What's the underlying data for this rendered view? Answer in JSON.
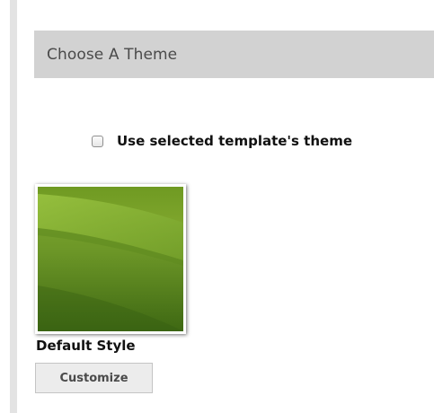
{
  "section": {
    "title": "Choose A Theme"
  },
  "theme_option": {
    "label": "Use selected template's theme",
    "checked": false
  },
  "themes": [
    {
      "name": "Default Style",
      "customize_label": "Customize",
      "swatch_colors": {
        "top": "#86b03a",
        "mid": "#6b9526",
        "bottom": "#3f6a14"
      }
    }
  ]
}
